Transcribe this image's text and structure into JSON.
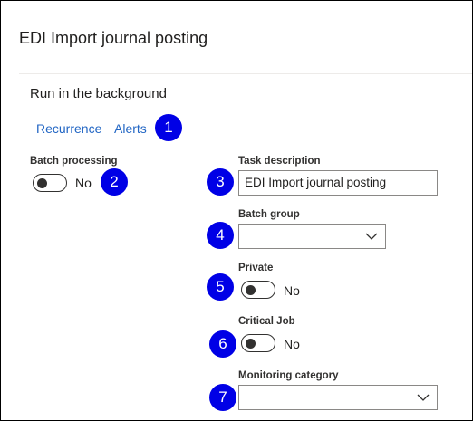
{
  "dialog": {
    "title": "EDI Import journal posting"
  },
  "section": {
    "title": "Run in the background"
  },
  "links": {
    "recurrence": "Recurrence",
    "alerts": "Alerts"
  },
  "batch_processing": {
    "label": "Batch processing",
    "value": "No"
  },
  "task_description": {
    "label": "Task description",
    "value": "EDI Import journal posting"
  },
  "batch_group": {
    "label": "Batch group",
    "value": ""
  },
  "private": {
    "label": "Private",
    "value": "No"
  },
  "critical_job": {
    "label": "Critical Job",
    "value": "No"
  },
  "monitoring_category": {
    "label": "Monitoring category",
    "value": ""
  },
  "callouts": [
    "1",
    "2",
    "3",
    "4",
    "5",
    "6",
    "7"
  ],
  "colors": {
    "link": "#2266c4",
    "callout": "#0000e6",
    "text": "#201f1e"
  },
  "icons": {
    "dropdown": "chevron-down-icon"
  }
}
